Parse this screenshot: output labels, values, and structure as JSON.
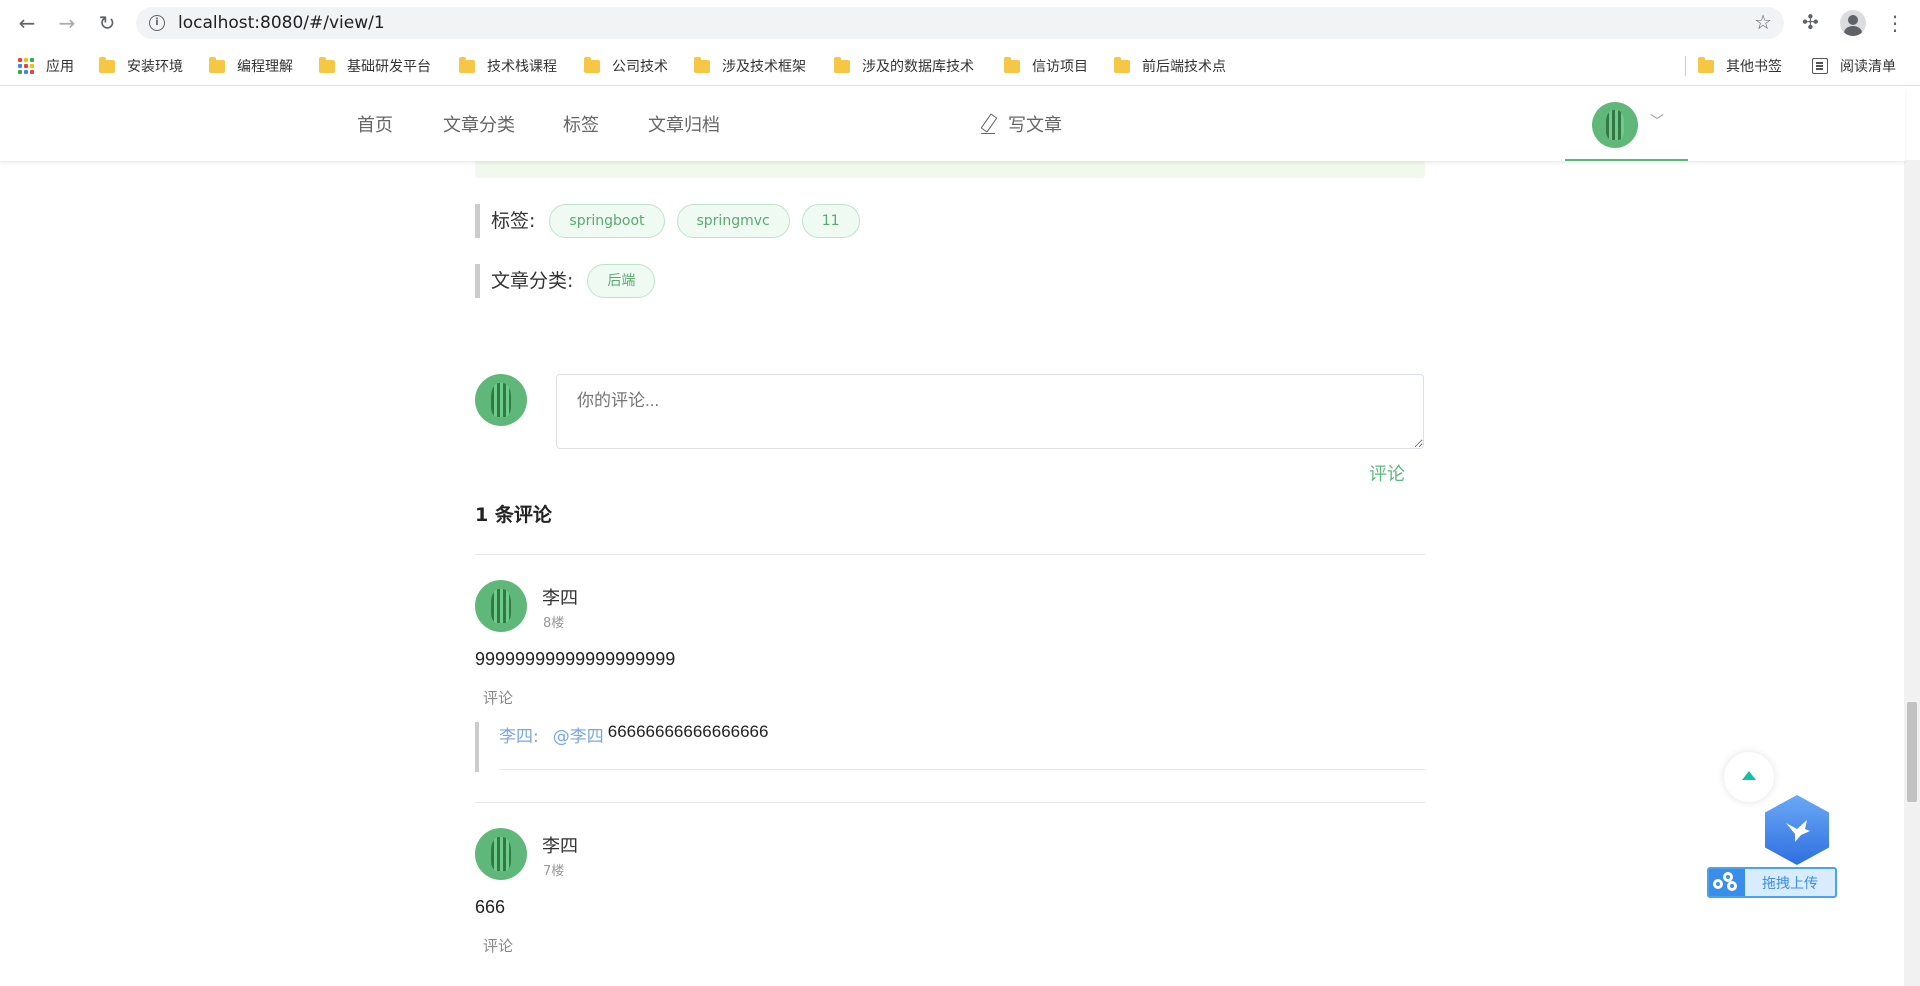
{
  "browser": {
    "url": "localhost:8080/#/view/1",
    "bookmarks": [
      {
        "label": "应用",
        "icon": "apps-grid-icon"
      },
      {
        "label": "安装环境",
        "icon": "folder-icon"
      },
      {
        "label": "编程理解",
        "icon": "folder-icon"
      },
      {
        "label": "基础研发平台",
        "icon": "folder-icon"
      },
      {
        "label": "技术栈课程",
        "icon": "folder-icon"
      },
      {
        "label": "公司技术",
        "icon": "folder-icon"
      },
      {
        "label": "涉及技术框架",
        "icon": "folder-icon"
      },
      {
        "label": "涉及的数据库技术",
        "icon": "folder-icon"
      },
      {
        "label": "信访项目",
        "icon": "folder-icon"
      },
      {
        "label": "前后端技术点",
        "icon": "folder-icon"
      }
    ],
    "other_bookmarks": "其他书签",
    "reading_list": "阅读清单"
  },
  "header": {
    "nav": [
      "首页",
      "文章分类",
      "标签",
      "文章归档"
    ],
    "write_label": "写文章"
  },
  "article_meta": {
    "tags_label": "标签:",
    "tags": [
      "springboot",
      "springmvc",
      "11"
    ],
    "category_label": "文章分类:",
    "category": "后端"
  },
  "comment_form": {
    "placeholder": "你的评论...",
    "submit_label": "评论"
  },
  "comments_title": "1 条评论",
  "comments": [
    {
      "author": "李四",
      "floor": "8楼",
      "content": "99999999999999999999",
      "reply_label": "评论",
      "replies": [
        {
          "author": "李四:",
          "at": "@李四",
          "content": "66666666666666666"
        }
      ]
    },
    {
      "author": "李四",
      "floor": "7楼",
      "content": "666",
      "reply_label": "评论"
    }
  ],
  "upload_widget": {
    "label": "拖拽上传"
  },
  "colors": {
    "accent_green": "#5cb87a",
    "link_blue": "#7aa7e0",
    "tag_bg": "#effaf2"
  }
}
